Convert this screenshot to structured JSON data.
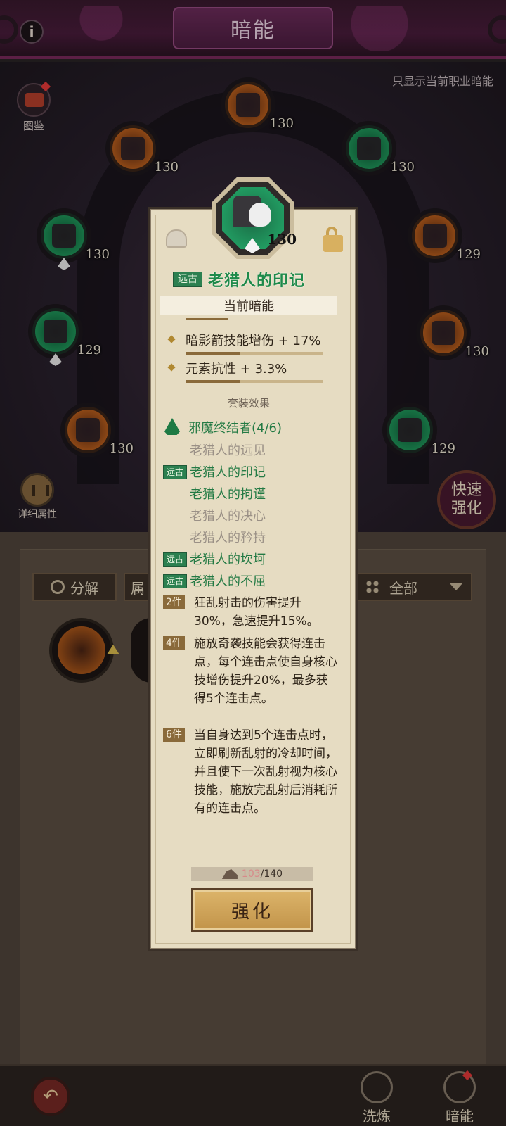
{
  "header": {
    "title": "暗能"
  },
  "filter_toggle": "只显示当前职业暗能",
  "codex_label": "图鉴",
  "tree_nodes": [
    {
      "level": "130",
      "color": "orange"
    },
    {
      "level": "130",
      "color": "orange"
    },
    {
      "level": "130",
      "color": "green"
    },
    {
      "level": "130",
      "color": "green"
    },
    {
      "level": "129",
      "color": "orange"
    },
    {
      "level": "129",
      "color": "green"
    },
    {
      "level": "130",
      "color": "orange"
    },
    {
      "level": "130",
      "color": "orange"
    },
    {
      "level": "129",
      "color": "green"
    }
  ],
  "detail_label": "详细属性",
  "quick_enhance": "快速强化",
  "inventory": {
    "decompose_label": "分解",
    "partial_label": "属",
    "filter_label": "全部"
  },
  "popup": {
    "emblem_level": "130",
    "rarity_tag": "远古",
    "name": "老猎人的印记",
    "current_section": "当前暗能",
    "stats": [
      {
        "text": "暗影箭技能增伤 + 17%",
        "progress": 0.4
      },
      {
        "text": "元素抗性 + 3.3%",
        "progress": 0.4
      }
    ],
    "set_section": "套装效果",
    "set_name": "邪魔终结者(4/6)",
    "set_items": [
      {
        "label": "老猎人的远见",
        "owned": false,
        "tag": ""
      },
      {
        "label": "老猎人的印记",
        "owned": true,
        "tag": "远古"
      },
      {
        "label": "老猎人的拘谨",
        "owned": true,
        "tag": ""
      },
      {
        "label": "老猎人的决心",
        "owned": false,
        "tag": ""
      },
      {
        "label": "老猎人的矜持",
        "owned": false,
        "tag": ""
      },
      {
        "label": "老猎人的坎坷",
        "owned": true,
        "tag": "远古"
      },
      {
        "label": "老猎人的不屈",
        "owned": true,
        "tag": "远古"
      }
    ],
    "bonuses": [
      {
        "pieces": "2件",
        "text": "狂乱射击的伤害提升30%，急速提升15%。"
      },
      {
        "pieces": "4件",
        "text": "施放奇袭技能会获得连击点，每个连击点使自身核心技增伤提升20%，最多获得5个连击点。"
      },
      {
        "pieces": "6件",
        "text": "当自身达到5个连击点时，立即刷新乱射的冷却时间，并且使下一次乱射视为核心技能，施放完乱射后消耗所有的连击点。"
      }
    ],
    "cost_have": "103",
    "cost_need": "/140",
    "enhance_label": "强化"
  },
  "bottom_nav": {
    "refine_label": "洗炼",
    "darkenergy_label": "暗能"
  },
  "colors": {
    "parchment": "#e6dcc2",
    "set_green": "#237a44",
    "header_purple": "#4a1c3c"
  }
}
